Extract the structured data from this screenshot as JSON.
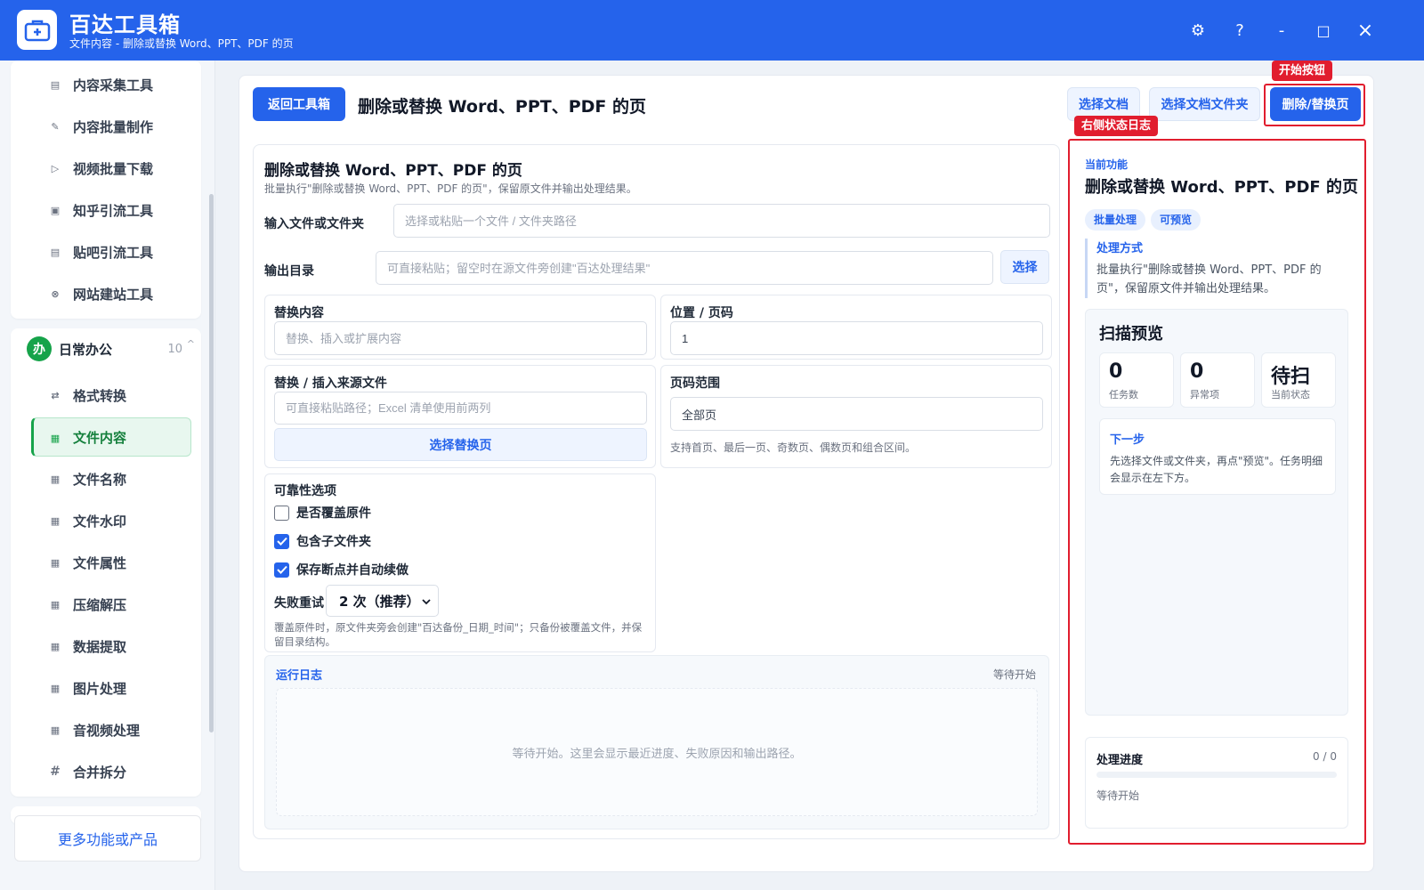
{
  "app": {
    "title": "百达工具箱",
    "subtitle": "文件内容 - 删除或替换 Word、PPT、PDF 的页"
  },
  "window_controls": {
    "settings": "⚙",
    "help": "?",
    "minimize": "-",
    "maximize": "□",
    "close": "×"
  },
  "sidebar": {
    "top_items": [
      {
        "label": "内容采集工具",
        "icon": "collect-icon"
      },
      {
        "label": "内容批量制作",
        "icon": "edit-icon"
      },
      {
        "label": "视频批量下载",
        "icon": "video-icon"
      },
      {
        "label": "知乎引流工具",
        "icon": "zhihu-icon"
      },
      {
        "label": "贴吧引流工具",
        "icon": "tieba-icon"
      },
      {
        "label": "网站建站工具",
        "icon": "website-icon"
      }
    ],
    "group": {
      "badge": "办",
      "label": "日常办公",
      "count": "10",
      "caret": "^"
    },
    "group_items": [
      {
        "label": "格式转换",
        "icon": "convert-icon",
        "glyph": "⇄"
      },
      {
        "label": "文件内容",
        "icon": "grid-icon",
        "glyph": "▦"
      },
      {
        "label": "文件名称",
        "icon": "grid-icon",
        "glyph": "▦"
      },
      {
        "label": "文件水印",
        "icon": "grid-icon",
        "glyph": "▦"
      },
      {
        "label": "文件属性",
        "icon": "grid-icon",
        "glyph": "▦"
      },
      {
        "label": "压缩解压",
        "icon": "grid-icon",
        "glyph": "▦"
      },
      {
        "label": "数据提取",
        "icon": "grid-icon",
        "glyph": "▦"
      },
      {
        "label": "图片处理",
        "icon": "grid-icon",
        "glyph": "▦"
      },
      {
        "label": "音视频处理",
        "icon": "grid-icon",
        "glyph": "▦"
      },
      {
        "label": "合并拆分",
        "icon": "hash-icon",
        "glyph": "#"
      }
    ],
    "active_item": "文件内容",
    "more_label": "更多功能或产品"
  },
  "header": {
    "back_label": "返回工具箱",
    "title": "删除或替换 Word、PPT、PDF 的页",
    "select_doc": "选择文档",
    "select_folder": "选择文档文件夹",
    "start": "删除/替换页",
    "start_tag": "开始按钮",
    "right_log_tag": "右侧状态日志"
  },
  "form": {
    "title": "删除或替换 Word、PPT、PDF 的页",
    "desc": "批量执行\"删除或替换 Word、PPT、PDF 的页\"，保留原文件并输出处理结果。",
    "input_label": "输入文件或文件夹",
    "input_placeholder": "选择或粘贴一个文件 / 文件夹路径",
    "output_label": "输出目录",
    "output_placeholder": "可直接粘贴；留空时在源文件旁创建\"百达处理结果\"",
    "output_select": "选择",
    "replace_content": {
      "label": "替换内容",
      "placeholder": "替换、插入或扩展内容"
    },
    "position": {
      "label": "位置 / 页码",
      "value": "1"
    },
    "source_file": {
      "label": "替换 / 插入来源文件",
      "placeholder": "可直接粘贴路径；Excel 清单使用前两列",
      "button": "选择替换页"
    },
    "page_range": {
      "label": "页码范围",
      "value": "全部页",
      "hint": "支持首页、最后一页、奇数页、偶数页和组合区间。"
    },
    "reliability": {
      "label": "可靠性选项",
      "overwrite": {
        "label": "是否覆盖原件",
        "checked": false
      },
      "subfolders": {
        "label": "包含子文件夹",
        "checked": true
      },
      "resume": {
        "label": "保存断点并自动续做",
        "checked": true
      },
      "retry_label": "失败重试",
      "retry_value": "2 次（推荐）",
      "note": "覆盖原件时，原文件夹旁会创建\"百达备份_日期_时间\"；只备份被覆盖文件，并保留目录结构。"
    },
    "log": {
      "title": "运行日志",
      "status": "等待开始",
      "empty": "等待开始。这里会显示最近进度、失败原因和输出路径。"
    }
  },
  "right_panel": {
    "current_label": "当前功能",
    "title": "删除或替换 Word、PPT、PDF 的页",
    "pills": [
      "批量处理",
      "可预览"
    ],
    "method_title": "处理方式",
    "method_desc": "批量执行\"删除或替换 Word、PPT、PDF 的页\"，保留原文件并输出处理结果。",
    "scan": {
      "title": "扫描预览",
      "stats": [
        {
          "value": "0",
          "label": "任务数"
        },
        {
          "value": "0",
          "label": "异常项"
        },
        {
          "value": "待扫",
          "label": "当前状态"
        }
      ],
      "next_title": "下一步",
      "next_desc": "先选择文件或文件夹，再点\"预览\"。任务明细会显示在左下方。"
    },
    "progress": {
      "title": "处理进度",
      "count": "0 / 0",
      "fraction": 0,
      "status": "等待开始"
    }
  },
  "colors": {
    "brand": "#2563eb",
    "accent_green": "#16a34a",
    "annotation_red": "#e11d2e"
  }
}
